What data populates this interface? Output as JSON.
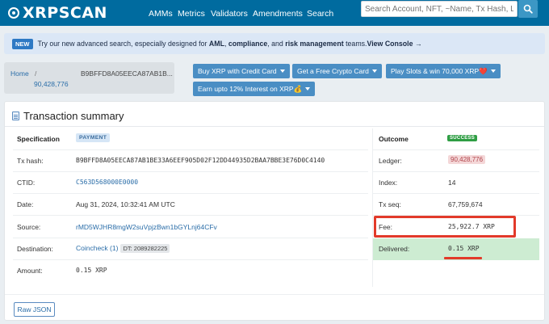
{
  "header": {
    "logo_text": "XRPSCAN",
    "nav": [
      "AMMs",
      "Metrics",
      "Validators",
      "Amendments",
      "Search"
    ],
    "search_placeholder": "Search Account, NFT, ~Name, Tx Hash, Ledger"
  },
  "banner": {
    "badge": "NEW",
    "text_1": " Try our new advanced search, especially designed for ",
    "bold_1": "AML",
    "text_2": ", ",
    "bold_2": "compliance",
    "text_3": ", and ",
    "bold_3": "risk management",
    "text_4": " teams. ",
    "link": "View Console →"
  },
  "breadcrumb": {
    "home": "Home",
    "sep": "/",
    "hash": "B9BFFD8A05EECA87AB1B...",
    "ledger": "90,428,776"
  },
  "promos": {
    "buy": "Buy XRP with Credit Card",
    "free_card": "Get a Free Crypto Card",
    "slots": "Play Slots & win 70,000 XRP❤️",
    "interest": "Earn upto 12% Interest on XRP💰"
  },
  "summary": {
    "title": "Transaction summary",
    "spec_label": "Specification",
    "type": "PAYMENT",
    "tx_hash_label": "Tx hash:",
    "tx_hash": "B9BFFD8A05EECA87AB1BE33A6EEF905D02F12DD44935D2BAA7BBE3E76D0C4140",
    "ctid_label": "CTID:",
    "ctid": "C563D568000E0000",
    "date_label": "Date:",
    "date": "Aug 31, 2024, 10:32:41 AM UTC",
    "source_label": "Source:",
    "source": "rMD5WJHR8mgW2suVpjzBwn1bGYLnj64CFv",
    "destination_label": "Destination:",
    "destination": "Coincheck (1)",
    "dest_tag": "DT: 2089282225",
    "amount_label": "Amount:",
    "amount": "0.15 XRP"
  },
  "outcome": {
    "label": "Outcome",
    "status": "SUCCESS",
    "ledger_label": "Ledger:",
    "ledger": "90,428,776",
    "index_label": "Index:",
    "index": "14",
    "txseq_label": "Tx seq:",
    "txseq": "67,759,674",
    "fee_label": "Fee:",
    "fee": "25,922.7 XRP",
    "delivered_label": "Delivered:",
    "delivered": "0.15 XRP"
  },
  "raw_json_label": "Raw JSON",
  "colors": {
    "header_bg": "#006b9f",
    "promo_bg": "#4a8ec4",
    "success": "#2f9e44",
    "highlight_red": "#e23a2a",
    "delivered_bg": "#cdecd2"
  }
}
